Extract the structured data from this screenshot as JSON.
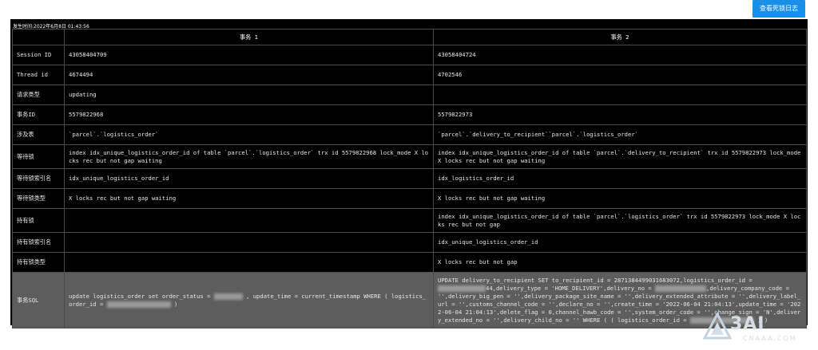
{
  "header": {
    "view_log_button": "查看死锁日志"
  },
  "event": {
    "timestamp_label": "发生时间:2022年6月8日 01:43:56"
  },
  "table": {
    "col_tx1": "事务 1",
    "col_tx2": "事务 2",
    "rows": [
      {
        "label": "Session ID",
        "tx1": "43058404709",
        "tx2": "43058404724"
      },
      {
        "label": "Thread id",
        "tx1": "4674494",
        "tx2": "4702546"
      },
      {
        "label": "请求类型",
        "tx1": "updating",
        "tx2": ""
      },
      {
        "label": "事务ID",
        "tx1": "5579822968",
        "tx2": "5579822973"
      },
      {
        "label": "涉及表",
        "tx1": "`parcel`.`logistics_order`",
        "tx2": "`parcel`.`delivery_to_recipient``parcel`.`logistics_order`"
      },
      {
        "label": "等待锁",
        "tx1": "index idx_unique_logistics_order_id of table `parcel`.`logistics_order` trx id 5579822968 lock_mode X locks rec but not gap waiting",
        "tx2": "index idx_unique_logistics_order_id of table `parcel`.`delivery_to_recipient` trx id 5579822973 lock_mode X locks rec but not gap waiting"
      },
      {
        "label": "等待锁索引名",
        "tx1": "idx_unique_logistics_order_id",
        "tx2": "idx_logistics_order_id"
      },
      {
        "label": "等待锁类型",
        "tx1": "X locks rec but not gap waiting",
        "tx2": "X locks rec but not gap waiting"
      },
      {
        "label": "持有锁",
        "tx1": "",
        "tx2": "index idx_unique_logistics_order_id of table `parcel`.`logistics_order` trx id 5579822973 lock_mode X locks rec but not gap"
      },
      {
        "label": "持有锁索引名",
        "tx1": "",
        "tx2": "idx_unique_logistics_order_id"
      },
      {
        "label": "持有锁类型",
        "tx1": "",
        "tx2": "X locks rec but not gap"
      }
    ],
    "sql": {
      "label": "事务SQL",
      "tx1_a": "update logistics_order set order_status = ",
      "tx1_b": " , update_time = current_timestamp WHERE ( logistics_order_id = ",
      "tx1_c": " )",
      "tx2_a": "UPDATE delivery_to_recipient SET to_recipient_id = 287138449903168307​2,logistics_order_id = ",
      "tx2_b": "44,delivery_type = 'HOME_DELIVERY',delivery_no = ",
      "tx2_c": ",delivery_company_code = '',delivery_big_pen = '',delivery_package_site_name = '',delivery_extended_attribute = '',delivery_label_url = '',customs_channel_code = '',declare_no = '',create_time = '2022-06-04 21:04:13',update_time = '2022-06-04 21:04:13',delete_flag = 0,channel_hawb_code = '',system_order_code = '',change_sign = 'N',delivery_extended_no = '',delivery_child_no = '' WHERE ( ( logistics_order_id = ",
      "tx2_d": " ) )"
    }
  },
  "watermark": {
    "main": "3AI",
    "sub": "CNAAA.COM"
  },
  "colors": {
    "label_green": "#46c038",
    "table_blue": "#3ea5ff",
    "button_blue": "#1a8fe8",
    "sql_row_bg": "#5d5d5d"
  }
}
